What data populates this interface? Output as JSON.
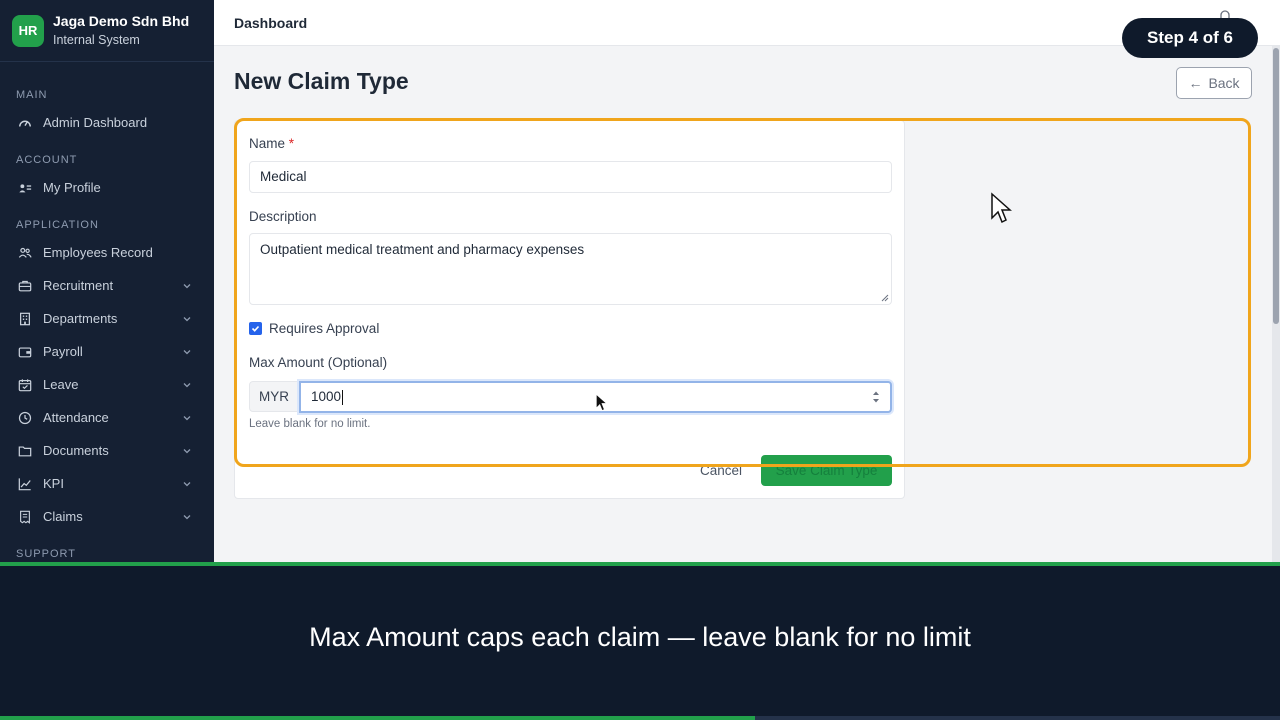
{
  "brand": {
    "logo": "HR",
    "name": "Jaga Demo Sdn Bhd",
    "subtitle": "Internal System"
  },
  "sidebar": {
    "sections": [
      "MAIN",
      "ACCOUNT",
      "APPLICATION",
      "SUPPORT"
    ],
    "items": [
      {
        "label": "Admin Dashboard",
        "icon": "gauge-icon"
      },
      {
        "label": "My Profile",
        "icon": "id-card-icon"
      },
      {
        "label": "Employees Record",
        "icon": "users-icon"
      },
      {
        "label": "Recruitment",
        "icon": "briefcase-icon"
      },
      {
        "label": "Departments",
        "icon": "building-icon"
      },
      {
        "label": "Payroll",
        "icon": "wallet-icon"
      },
      {
        "label": "Leave",
        "icon": "calendar-icon"
      },
      {
        "label": "Attendance",
        "icon": "clock-icon"
      },
      {
        "label": "Documents",
        "icon": "folder-icon"
      },
      {
        "label": "KPI",
        "icon": "chart-line-icon"
      },
      {
        "label": "Claims",
        "icon": "receipt-icon"
      }
    ]
  },
  "topbar": {
    "title": "Dashboard"
  },
  "tour": {
    "step_label": "Step 4 of 6",
    "progress": 0.59
  },
  "page": {
    "title": "New Claim Type",
    "back_label": "Back"
  },
  "form": {
    "name_label": "Name",
    "name_required_mark": "*",
    "name_value": "Medical",
    "description_label": "Description",
    "description_value": "Outpatient medical treatment and pharmacy expenses",
    "requires_approval_label": "Requires Approval",
    "requires_approval_checked": true,
    "max_amount_label": "Max Amount (Optional)",
    "currency": "MYR",
    "max_amount_value": "1000",
    "max_amount_hint": "Leave blank for no limit.",
    "cancel_label": "Cancel",
    "save_label": "Save Claim Type"
  },
  "caption": "Max Amount caps each claim — leave blank for no limit",
  "colors": {
    "sidebar": "#152033",
    "accent_green": "#22a04b",
    "highlight": "#f0a51c",
    "caption_bg": "#0f1a2b"
  }
}
